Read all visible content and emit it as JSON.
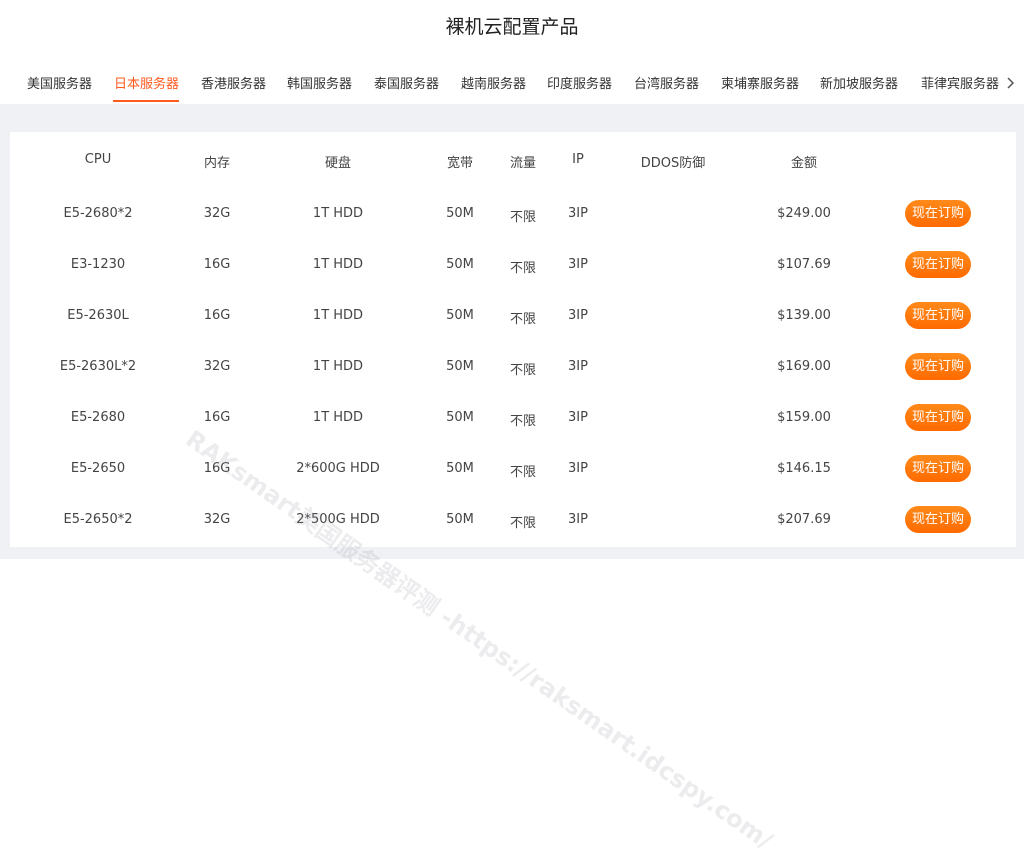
{
  "page_title": "裸机云配置产品",
  "tabs": [
    {
      "label": "美国服务器"
    },
    {
      "label": "日本服务器"
    },
    {
      "label": "香港服务器"
    },
    {
      "label": "韩国服务器"
    },
    {
      "label": "泰国服务器"
    },
    {
      "label": "越南服务器"
    },
    {
      "label": "印度服务器"
    },
    {
      "label": "台湾服务器"
    },
    {
      "label": "柬埔寨服务器"
    },
    {
      "label": "新加坡服务器"
    },
    {
      "label": "菲律宾服务器"
    }
  ],
  "active_tab_index": 1,
  "table": {
    "headers": {
      "cpu": "CPU",
      "ram": "内存",
      "disk": "硬盘",
      "bandwidth": "宽带",
      "traffic": "流量",
      "ip": "IP",
      "ddos": "DDOS防御",
      "price": "金额"
    },
    "rows": [
      {
        "cpu": "E5-2680*2",
        "ram": "32G",
        "disk": "1T HDD",
        "bandwidth": "50M",
        "traffic": "不限",
        "ip": "3IP",
        "ddos": "",
        "price": "$249.00",
        "button": "现在订购"
      },
      {
        "cpu": "E3-1230",
        "ram": "16G",
        "disk": "1T HDD",
        "bandwidth": "50M",
        "traffic": "不限",
        "ip": "3IP",
        "ddos": "",
        "price": "$107.69",
        "button": "现在订购"
      },
      {
        "cpu": "E5-2630L",
        "ram": "16G",
        "disk": "1T HDD",
        "bandwidth": "50M",
        "traffic": "不限",
        "ip": "3IP",
        "ddos": "",
        "price": "$139.00",
        "button": "现在订购"
      },
      {
        "cpu": "E5-2630L*2",
        "ram": "32G",
        "disk": "1T HDD",
        "bandwidth": "50M",
        "traffic": "不限",
        "ip": "3IP",
        "ddos": "",
        "price": "$169.00",
        "button": "现在订购"
      },
      {
        "cpu": "E5-2680",
        "ram": "16G",
        "disk": "1T HDD",
        "bandwidth": "50M",
        "traffic": "不限",
        "ip": "3IP",
        "ddos": "",
        "price": "$159.00",
        "button": "现在订购"
      },
      {
        "cpu": "E5-2650",
        "ram": "16G",
        "disk": "2*600G HDD",
        "bandwidth": "50M",
        "traffic": "不限",
        "ip": "3IP",
        "ddos": "",
        "price": "$146.15",
        "button": "现在订购"
      },
      {
        "cpu": "E5-2650*2",
        "ram": "32G",
        "disk": "2*500G HDD",
        "bandwidth": "50M",
        "traffic": "不限",
        "ip": "3IP",
        "ddos": "",
        "price": "$207.69",
        "button": "现在订购"
      }
    ]
  },
  "watermark_text": "RAKsmart美国服务器评测 -https://raksmart.idcspy.com/",
  "colors": {
    "accent": "#ff5a1f",
    "button": "#ff7a00",
    "panel_bg": "#f0f1f4"
  }
}
